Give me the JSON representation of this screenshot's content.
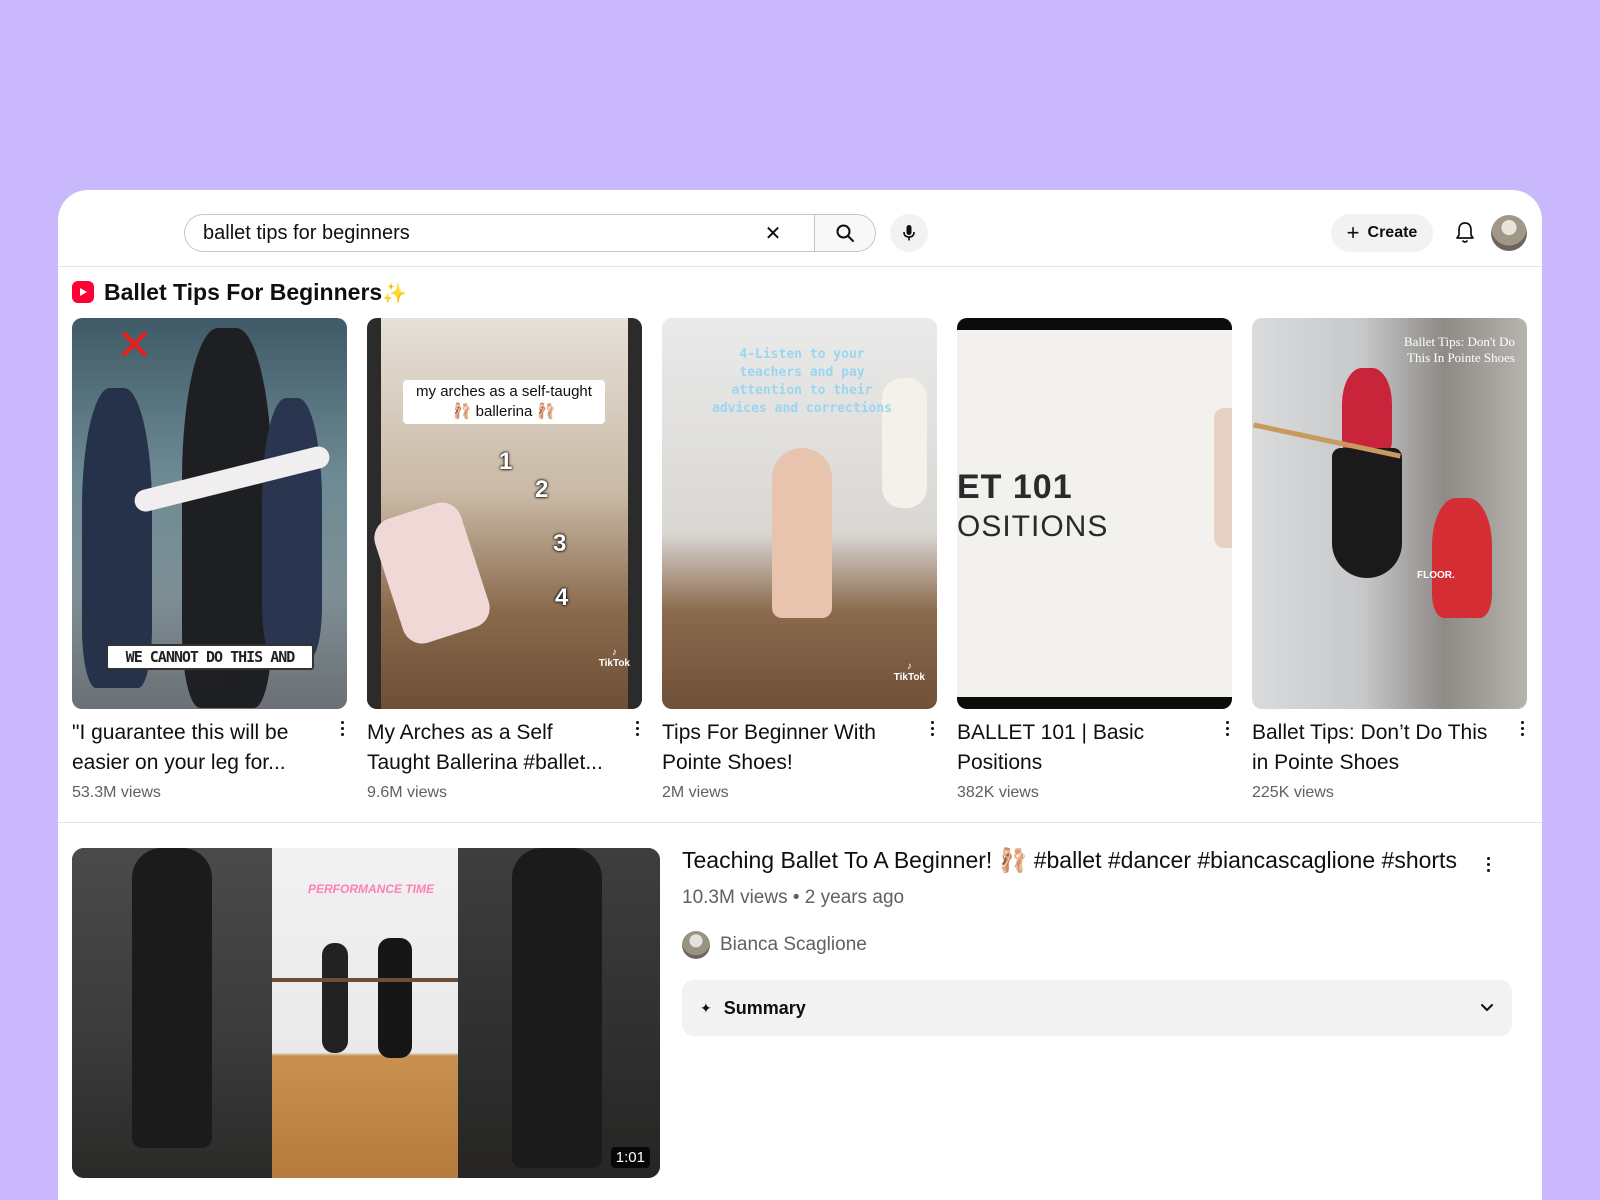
{
  "search": {
    "value": "ballet tips for beginners",
    "clear_icon": "close-icon",
    "search_icon": "search-icon",
    "mic_icon": "mic-icon"
  },
  "header": {
    "create_label": "Create",
    "bell_icon": "bell-icon"
  },
  "shorts": {
    "section_title": "Ballet Tips For Beginners",
    "section_emoji": "✨",
    "items": [
      {
        "title": "\"I guarantee this will be easier on your leg for...",
        "views": "53.3M views",
        "overlay_caption": "WE CANNOT DO THIS AND THIS."
      },
      {
        "title": "My Arches as a Self Taught Ballerina #ballet...",
        "views": "9.6M views",
        "overlay_caption": "my arches as a self-taught 🩰 ballerina 🩰",
        "numbers": [
          "1",
          "2",
          "3",
          "4"
        ]
      },
      {
        "title": "Tips For Beginner With Pointe Shoes!",
        "views": "2M views",
        "overlay_caption": "4-Listen to your teachers and pay attention to their advices and corrections"
      },
      {
        "title": "BALLET 101 | Basic Positions",
        "views": "382K views",
        "overlay_line1": "ET 101",
        "overlay_line2": "OSITIONS"
      },
      {
        "title": "Ballet Tips: Don’t Do This in Pointe Shoes",
        "views": "225K views",
        "overlay_caption": "Ballet Tips: Don't Do This In Pointe Shoes",
        "overlay_floor": "FLOOR."
      }
    ],
    "tiktok_label": "TikTok"
  },
  "video": {
    "title": "Teaching Ballet To A Beginner! 🩰  #ballet #dancer #biancascaglione #shorts",
    "meta": "10.3M views • 2 years ago",
    "channel": "Bianca Scaglione",
    "duration": "1:01",
    "thumb_caption": "PERFORMANCE TIME",
    "summary_label": "Summary"
  },
  "colors": {
    "page_background": "#c9b8fb",
    "accent_red": "#ff0033",
    "secondary_text": "#606060"
  }
}
